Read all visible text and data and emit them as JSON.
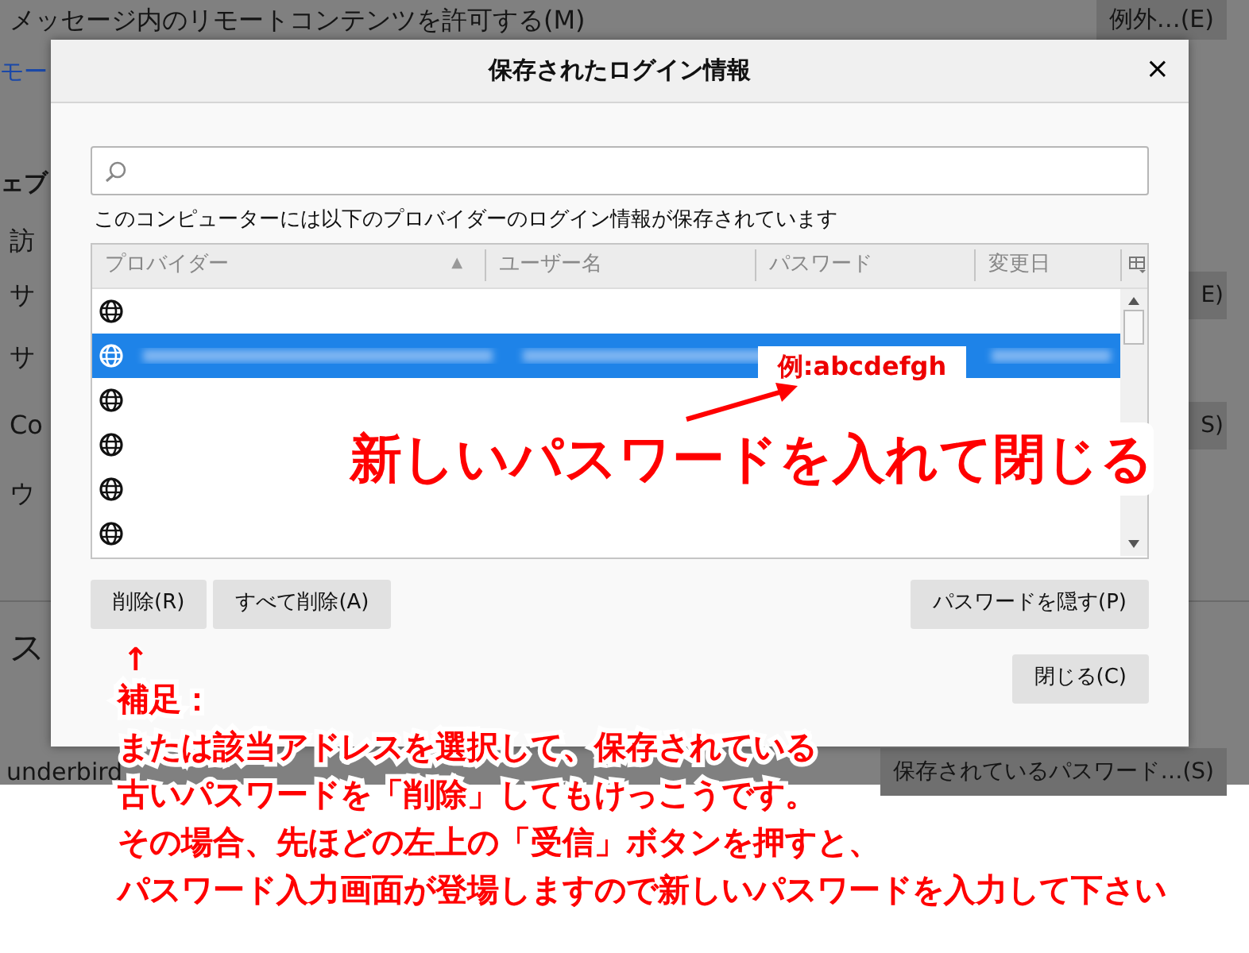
{
  "background_page": {
    "remote_content_label": "メッセージ内のリモートコンテンツを許可する(M)",
    "exceptions_button": "例外…(E)",
    "fragments": [
      {
        "kind": "link",
        "text": "モー"
      },
      {
        "kind": "heading",
        "text": "ェブ"
      },
      {
        "kind": "text",
        "text": "訪"
      },
      {
        "kind": "text",
        "text": "サ",
        "button": "E)"
      },
      {
        "kind": "text",
        "text": "サ"
      },
      {
        "kind": "text",
        "text": "Co",
        "button": "S)"
      },
      {
        "kind": "text",
        "text": "ウ"
      },
      {
        "kind": "big",
        "text": "ス"
      },
      {
        "kind": "text",
        "text": "underbird",
        "button": "保存されているパスワード…(S)"
      }
    ]
  },
  "dialog": {
    "title": "保存されたログイン情報",
    "close": "×",
    "caption": "このコンピューターには以下のプロバイダーのログイン情報が保存されています",
    "columns": [
      {
        "label": "プロバイダー",
        "sort": "▲"
      },
      {
        "label": "ユーザー名"
      },
      {
        "label": "パスワード"
      },
      {
        "label": "変更日"
      }
    ],
    "rows": [
      {
        "selected": false
      },
      {
        "selected": true
      },
      {
        "selected": false
      },
      {
        "selected": false
      },
      {
        "selected": false
      },
      {
        "selected": false
      }
    ],
    "buttons": [
      "削除(R)",
      "すべて削除(A)",
      "パスワードを隠す(P)"
    ],
    "close_button": "閉じる(C)"
  },
  "annotations": {
    "example": "例:abcdefgh",
    "instruction": "新しいパスワードを入れて閉じる",
    "up_arrow": "↑",
    "note_lines": [
      "補足：",
      "または該当アドレスを選択して、保存されている",
      "古いパスワードを「削除」してもけっこうです。",
      "その場合、先ほどの左上の「受信」ボタンを押すと、",
      "パスワード入力画面が登場しますので新しいパスワードを入力して下さい"
    ]
  }
}
